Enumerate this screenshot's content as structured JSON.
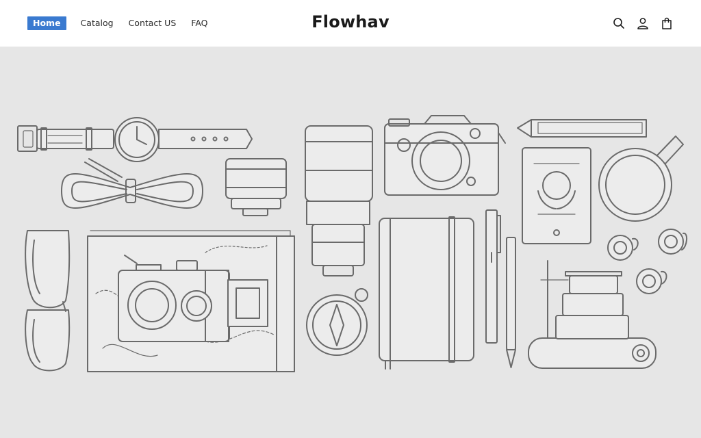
{
  "header": {
    "nav": [
      {
        "label": "Home",
        "active": true
      },
      {
        "label": "Catalog",
        "active": false
      },
      {
        "label": "Contact US",
        "active": false
      },
      {
        "label": "FAQ",
        "active": false
      }
    ],
    "brand": "Flowhav",
    "icons": [
      "search-icon",
      "account-icon",
      "cart-icon"
    ]
  },
  "hero": {
    "illustration": "travel-gear-line-art",
    "items": [
      "wristwatch",
      "camera-strap",
      "lens",
      "zoom-lens",
      "retro-camera",
      "pencil",
      "passport",
      "mug",
      "sunglasses",
      "map",
      "film-camera",
      "compass",
      "notebook",
      "pen",
      "pencil",
      "film-rolls",
      "compact-camera"
    ]
  },
  "colors": {
    "accent": "#3a7ad0",
    "hero_background": "#e6e6e6",
    "line_art": "#6a6a6a"
  }
}
